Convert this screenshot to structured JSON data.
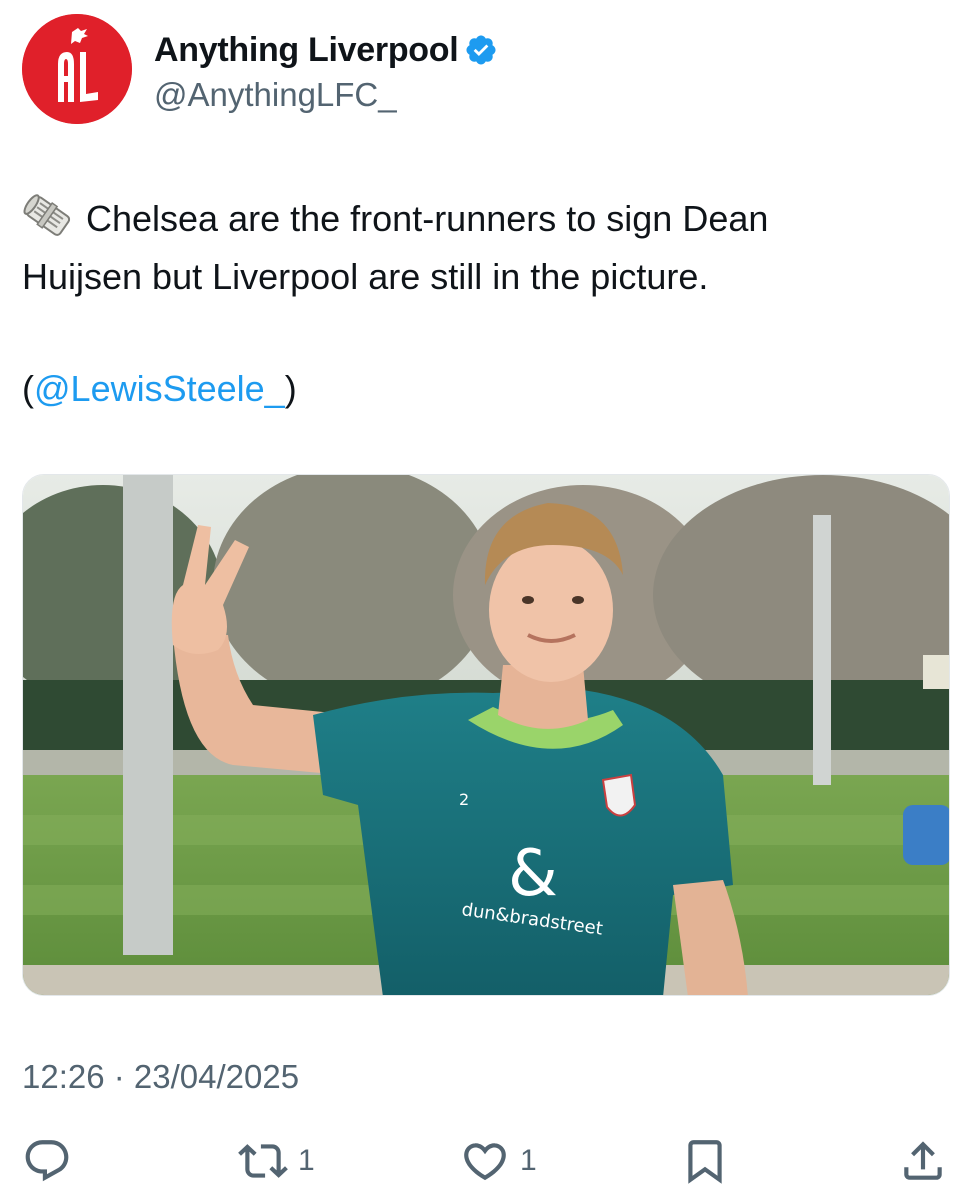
{
  "author": {
    "display_name": "Anything Liverpool",
    "handle": "@AnythingLFC_",
    "avatar_initials": "AL",
    "verified": true,
    "verified_color": "#1d9bf0",
    "avatar_color": "#e0202a"
  },
  "tweet": {
    "icon": "newspaper-icon",
    "line1": "Chelsea are the front-runners to sign Dean",
    "line2": "Huijsen but Liverpool are still in the picture.",
    "mention_open": "(",
    "mention": "@LewisSteele_",
    "mention_close": ")",
    "link_color": "#1d9bf0"
  },
  "media": {
    "kind": "photo",
    "shirt_number": "2",
    "sponsor": "dun&bradstreet"
  },
  "timestamp": "12:26 · 23/04/2025",
  "actions": {
    "reply": {
      "icon": "reply-icon",
      "count": ""
    },
    "retweet": {
      "icon": "retweet-icon",
      "count": "1"
    },
    "like": {
      "icon": "heart-icon",
      "count": "1"
    },
    "bookmark": {
      "icon": "bookmark-icon",
      "count": ""
    },
    "share": {
      "icon": "share-icon",
      "count": ""
    }
  }
}
